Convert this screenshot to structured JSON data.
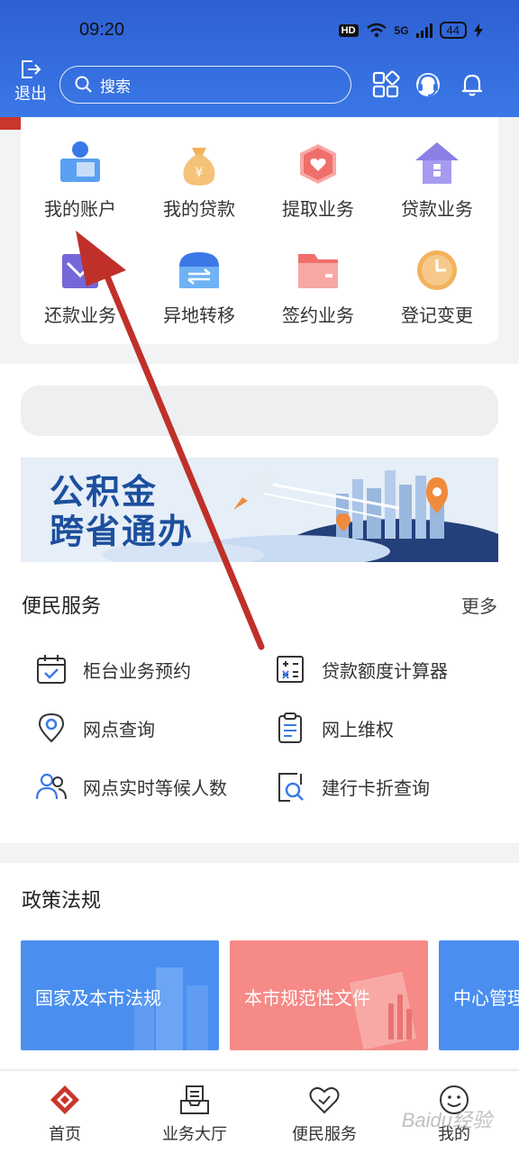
{
  "status_bar": {
    "time": "09:20",
    "hd": "HD",
    "network": "5G",
    "battery": "44"
  },
  "header": {
    "exit_label": "退出",
    "search_placeholder": "搜索"
  },
  "quick_grid": [
    {
      "label": "我的账户",
      "icon": "account-icon"
    },
    {
      "label": "我的贷款",
      "icon": "money-bag-icon"
    },
    {
      "label": "提取业务",
      "icon": "withdraw-icon"
    },
    {
      "label": "贷款业务",
      "icon": "house-icon"
    },
    {
      "label": "还款业务",
      "icon": "repay-icon"
    },
    {
      "label": "异地转移",
      "icon": "transfer-icon"
    },
    {
      "label": "签约业务",
      "icon": "folder-icon"
    },
    {
      "label": "登记变更",
      "icon": "clock-icon"
    }
  ],
  "banner": {
    "line1": "公积金",
    "line2": "跨省通办"
  },
  "convenience": {
    "title": "便民服务",
    "more": "更多",
    "items": [
      {
        "label": "柜台业务预约",
        "icon": "calendar-icon"
      },
      {
        "label": "贷款额度计算器",
        "icon": "calculator-icon"
      },
      {
        "label": "网点查询",
        "icon": "location-icon"
      },
      {
        "label": "网上维权",
        "icon": "clipboard-icon"
      },
      {
        "label": "网点实时等候人数",
        "icon": "people-icon"
      },
      {
        "label": "建行卡折查询",
        "icon": "search-doc-icon"
      }
    ]
  },
  "policy": {
    "title": "政策法规",
    "cards": [
      {
        "label": "国家及本市法规",
        "color": "#4a8ff0"
      },
      {
        "label": "本市规范性文件",
        "color": "#f58a87"
      },
      {
        "label": "中心管理",
        "color": "#4a8ff0"
      }
    ]
  },
  "tabbar": [
    {
      "label": "首页",
      "icon": "home-logo-icon"
    },
    {
      "label": "业务大厅",
      "icon": "inbox-icon"
    },
    {
      "label": "便民服务",
      "icon": "heart-icon"
    },
    {
      "label": "我的",
      "icon": "smile-icon"
    }
  ],
  "watermark": "Baidu经验",
  "colors": {
    "header_blue": "#2e5fd3",
    "accent_red": "#c8362c",
    "annotation_arrow": "#c0302a"
  }
}
